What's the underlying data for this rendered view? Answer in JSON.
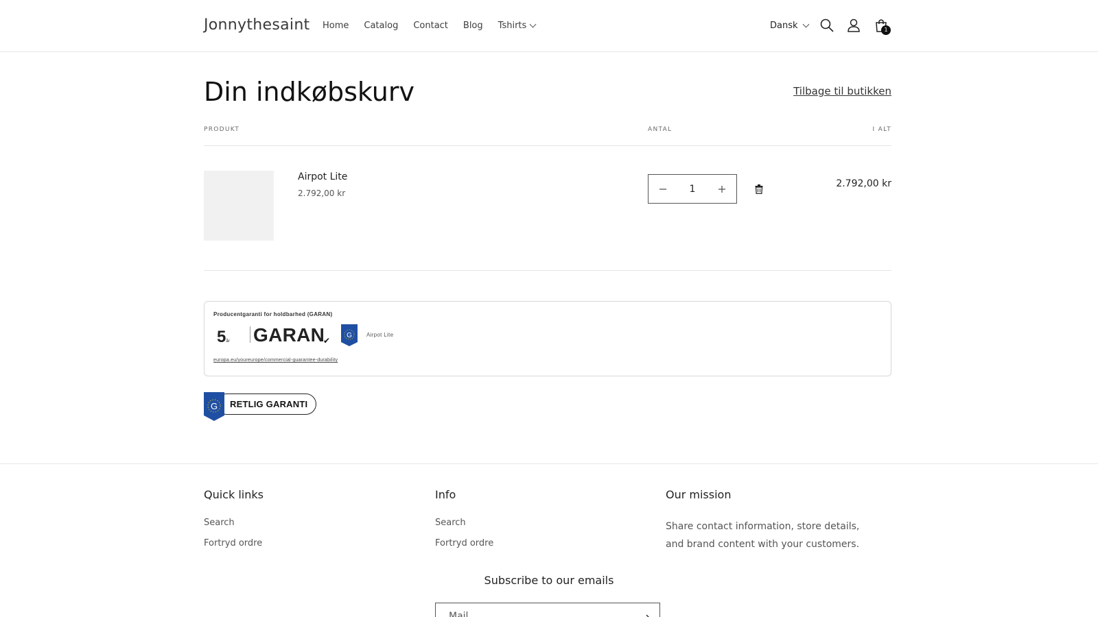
{
  "header": {
    "logo": "Jonnythesaint",
    "nav": [
      "Home",
      "Catalog",
      "Contact",
      "Blog"
    ],
    "nav_dropdown": "Tshirts",
    "language": "Dansk",
    "cart_count": "1",
    "icons": [
      "search-icon",
      "account-icon",
      "cart-icon"
    ]
  },
  "cart": {
    "title": "Din indkøbskurv",
    "back_link": "Tilbage til butikken",
    "col_product": "PRODUKT",
    "col_qty": "ANTAL",
    "col_total": "I ALT",
    "item": {
      "name": "Airpot Lite",
      "unit_price": "2.792,00 kr",
      "quantity": "1",
      "line_total": "2.792,00 kr"
    }
  },
  "guarantee": {
    "title": "Producentgaranti for holdbarhed (GARAN)",
    "years": "5",
    "years_unit": "år",
    "label": "GARAN",
    "product": "Airpot Lite",
    "link": "europa.eu/youreurope/commercial-guarantee-durability",
    "legal_button": "RETLIG GARANTI"
  },
  "footer": {
    "quick_links": {
      "heading": "Quick links",
      "links": [
        "Search",
        "Fortryd ordre"
      ]
    },
    "info": {
      "heading": "Info",
      "links": [
        "Search",
        "Fortryd ordre"
      ]
    },
    "mission": {
      "heading": "Our mission",
      "text": "Share contact information, store details, and brand content with your customers."
    },
    "subscribe_title": "Subscribe to our emails",
    "email_placeholder": "Mail"
  },
  "colors": {
    "accent": "#121212",
    "eu_blue": "#1f4fa3",
    "eu_star": "#f5d000"
  }
}
